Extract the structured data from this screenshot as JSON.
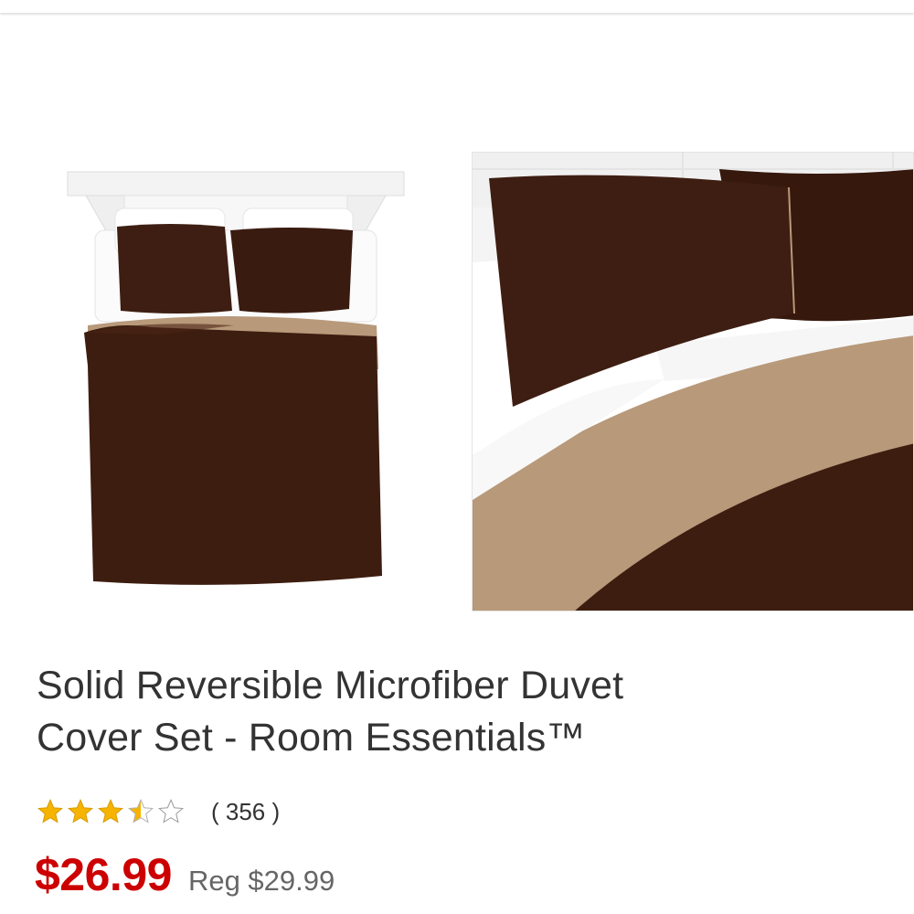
{
  "product": {
    "title_line1": "Solid Reversible Microfiber Duvet",
    "title_line2": "Cover Set - Room Essentials™",
    "rating": {
      "value": 3.5,
      "max": 5,
      "review_count": "( 356 )"
    },
    "price": {
      "sale": "$26.99",
      "regular": "Reg $29.99"
    }
  },
  "colors": {
    "sale": "#cc0000",
    "star_fill": "#f6b400",
    "duvet_brown": "#3d1d10",
    "duvet_tan": "#b89b78"
  }
}
